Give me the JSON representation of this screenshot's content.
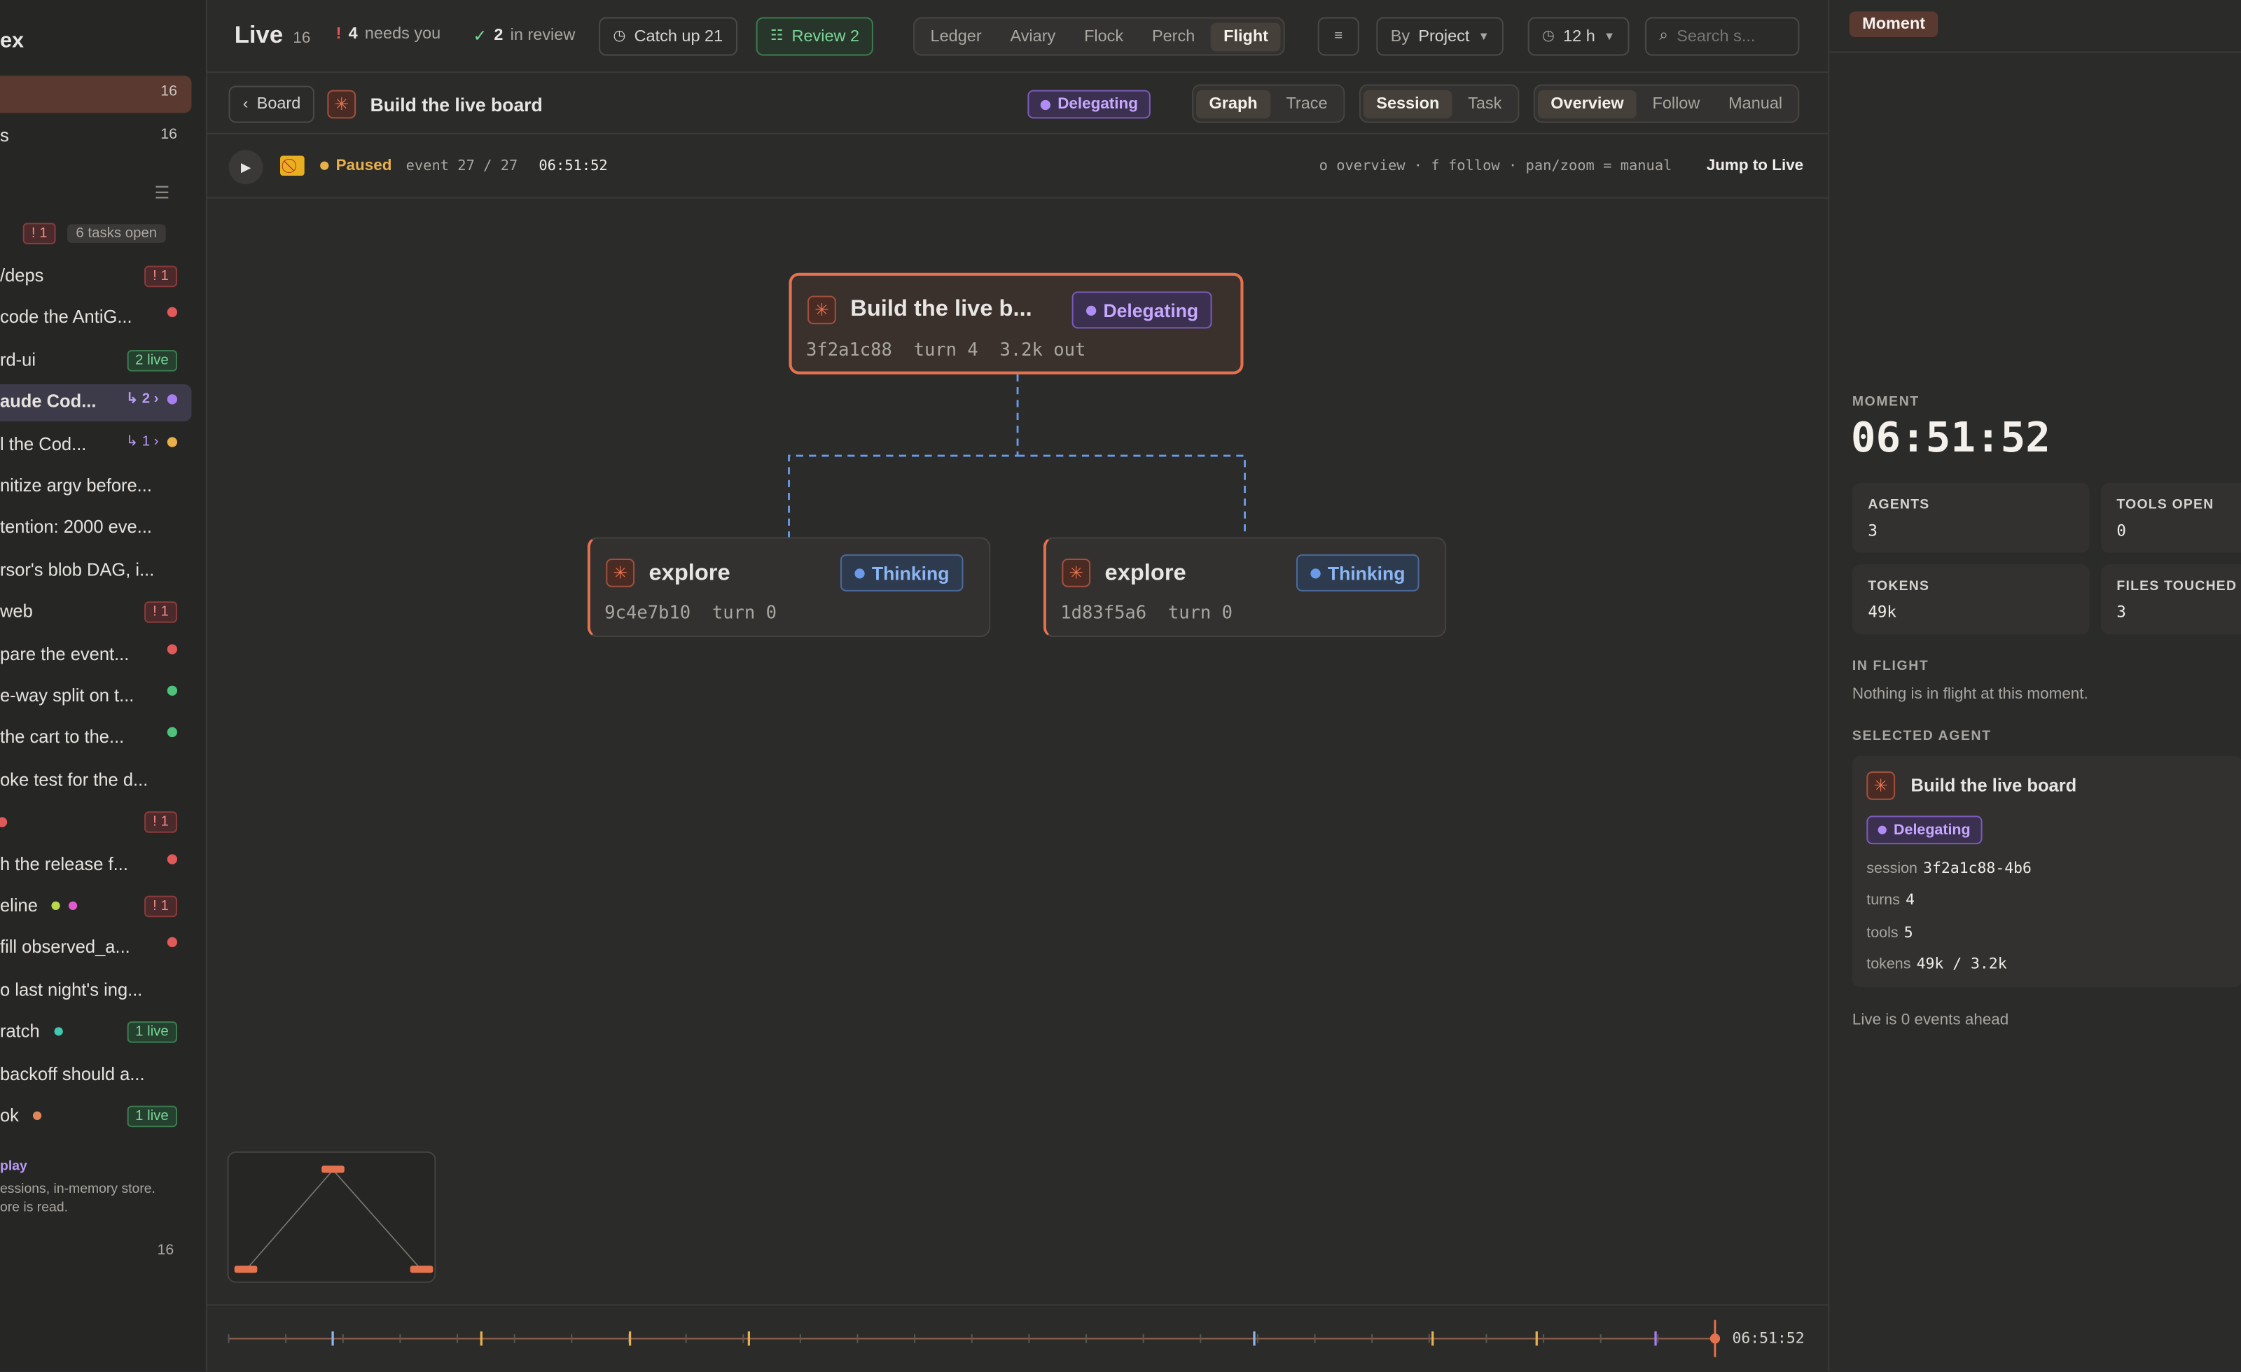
{
  "sidebar": {
    "title": "ex",
    "top_rows": [
      {
        "label": "",
        "count": "16"
      },
      {
        "label": "s",
        "count": "16"
      }
    ],
    "tasks_open": "6 tasks open",
    "tasks_badge": "! 1",
    "items": [
      {
        "label": "/deps",
        "badge": "! 1",
        "kind": "red"
      },
      {
        "label": "code the AntiG...",
        "dot": "#e05a5a"
      },
      {
        "label": "rd-ui",
        "badge": "2 live",
        "kind": "green"
      },
      {
        "label": "aude Cod...",
        "sub": "↳ 2 ›",
        "dot": "#a67ef0",
        "selected": true
      },
      {
        "label": "l the Cod...",
        "sub": "↳ 1 ›",
        "dot": "#e8b04a"
      },
      {
        "label": "nitize argv before..."
      },
      {
        "label": "tention: 2000 eve..."
      },
      {
        "label": "rsor's blob DAG, i..."
      },
      {
        "label": "web",
        "badge": "! 1",
        "kind": "red"
      },
      {
        "label": "pare the event...",
        "dot": "#e05a5a"
      },
      {
        "label": "e-way split on t...",
        "dot": "#4ec27a"
      },
      {
        "label": "the cart to the...",
        "dot": "#4ec27a"
      },
      {
        "label": "oke test for the d..."
      },
      {
        "label": "",
        "badge": "! 1",
        "kind": "red",
        "ldot": "#e05a5a"
      },
      {
        "label": "h the release f...",
        "dot": "#e05a5a"
      },
      {
        "label": "eline",
        "badge": "! 1",
        "kind": "red",
        "dots": [
          "#b8d84a",
          "#e05acb"
        ]
      },
      {
        "label": "fill observed_a...",
        "dot": "#e05a5a"
      },
      {
        "label": "o last night's ing..."
      },
      {
        "label": "ratch",
        "badge": "1 live",
        "kind": "green",
        "idot": "#3fc9b0"
      },
      {
        "label": " backoff should a..."
      },
      {
        "label": "ok",
        "badge": "1 live",
        "kind": "green",
        "idot": "#e0875a"
      }
    ],
    "footer_title": "play",
    "footer_line1": "essions, in-memory store.",
    "footer_line2": "ore is read.",
    "footer_count": "16"
  },
  "header": {
    "title": "Live",
    "count": "16",
    "needs_num": "4",
    "needs_label": "needs you",
    "review_num": "2",
    "review_label": "in review",
    "catch_up": "Catch up 21",
    "review_btn": "Review 2",
    "views": [
      "Ledger",
      "Aviary",
      "Flock",
      "Perch",
      "Flight"
    ],
    "active_view": "Flight",
    "group_prefix": "By",
    "group_value": "Project",
    "range": "12 h",
    "search_placeholder": "Search s..."
  },
  "subheader": {
    "back": "Board",
    "title": "Build the live board",
    "status": "Delegating",
    "mode_a": [
      "Graph",
      "Trace"
    ],
    "mode_b": [
      "Session",
      "Task"
    ],
    "mode_c": [
      "Overview",
      "Follow",
      "Manual"
    ]
  },
  "playbar": {
    "state": "Paused",
    "event": "event 27 / 27",
    "time": "06:51:52",
    "hint": "o overview · f follow · pan/zoom = manual",
    "jump": "Jump to Live"
  },
  "graph": {
    "root": {
      "title": "Build the live b...",
      "status": "Delegating",
      "meta": "3f2a1c88  turn 4  3.2k out"
    },
    "children": [
      {
        "title": "explore",
        "status": "Thinking",
        "meta": "9c4e7b10  turn 0"
      },
      {
        "title": "explore",
        "status": "Thinking",
        "meta": "1d83f5a6  turn 0"
      }
    ]
  },
  "timeline": {
    "time": "06:51:52",
    "marks": [
      {
        "pos": 0.07,
        "color": "#8cb6f2"
      },
      {
        "pos": 0.17,
        "color": "#e8b04a"
      },
      {
        "pos": 0.27,
        "color": "#e8b04a"
      },
      {
        "pos": 0.35,
        "color": "#e8b04a"
      },
      {
        "pos": 0.69,
        "color": "#8cb6f2"
      },
      {
        "pos": 0.81,
        "color": "#e8b04a"
      },
      {
        "pos": 0.88,
        "color": "#e8b04a"
      },
      {
        "pos": 0.96,
        "color": "#a67ef0"
      }
    ]
  },
  "right": {
    "tab": "Moment",
    "moment_label": "MOMENT",
    "moment_time": "06:51:52",
    "stats": [
      {
        "k": "AGENTS",
        "v": "3"
      },
      {
        "k": "TOOLS OPEN",
        "v": "0"
      },
      {
        "k": "TOKENS",
        "v": "49k"
      },
      {
        "k": "FILES TOUCHED",
        "v": "3"
      }
    ],
    "in_flight_label": "IN FLIGHT",
    "in_flight_text": "Nothing is in flight at this moment.",
    "selected_label": "SELECTED AGENT",
    "agent_title": "Build the live board",
    "agent_status": "Delegating",
    "fields": [
      {
        "k": "session",
        "v": "3f2a1c88-4b6"
      },
      {
        "k": "turns",
        "v": "4"
      },
      {
        "k": "tools",
        "v": "5"
      },
      {
        "k": "tokens",
        "v": "49k / 3.2k"
      }
    ],
    "live_ahead": "Live is 0 events ahead"
  },
  "colors": {
    "accent": "#e5724f",
    "purple": "#a67ef0",
    "blue": "#6a9ae8",
    "green": "#79d696"
  }
}
